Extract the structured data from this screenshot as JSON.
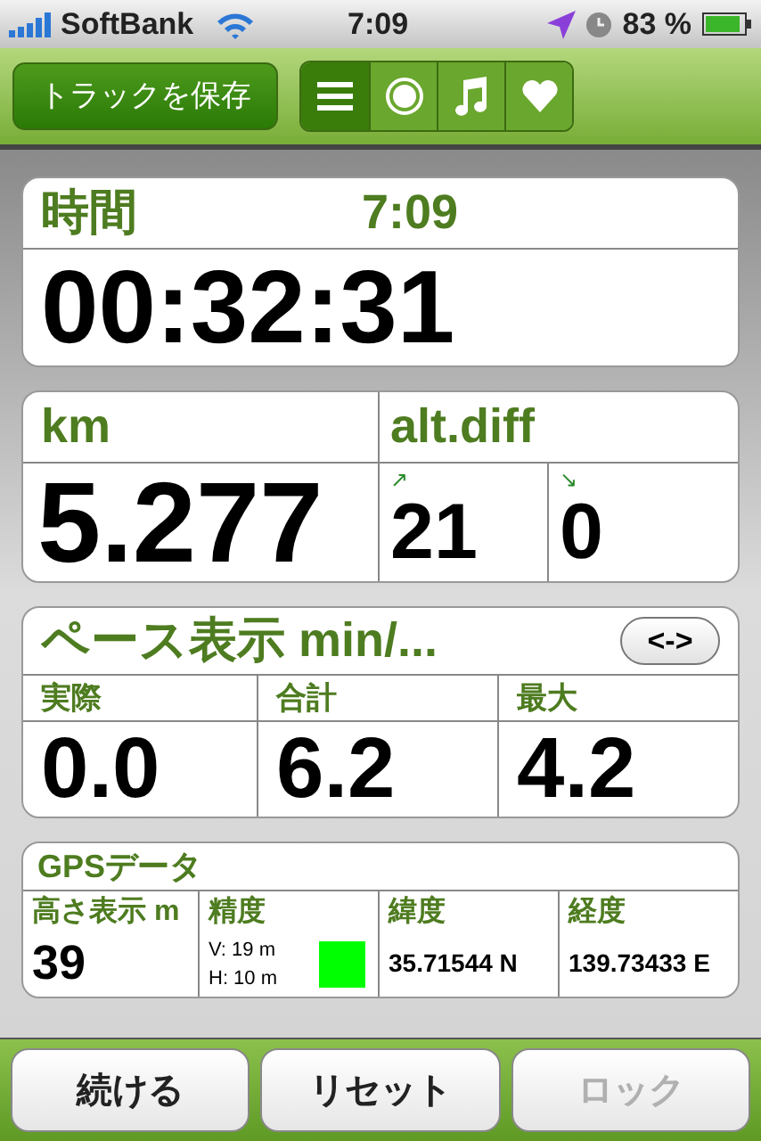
{
  "status_bar": {
    "carrier": "SoftBank",
    "time": "7:09",
    "battery": "83 %"
  },
  "toolbar": {
    "save_button": "トラックを保存",
    "segments": [
      {
        "kind": "list",
        "selected": true
      },
      {
        "kind": "record",
        "selected": false
      },
      {
        "kind": "music",
        "selected": false
      },
      {
        "kind": "heart",
        "selected": false
      }
    ]
  },
  "time_card": {
    "label": "時間",
    "clock": "7:09",
    "value": "00:32:31"
  },
  "distance_card": {
    "label": "km",
    "value": "5.277",
    "alt_label": "alt.diff",
    "up_arrow": "↗",
    "up": "21",
    "down_arrow": "↘",
    "down": "0"
  },
  "pace_card": {
    "label": "ペース表示 min/...",
    "toggle": "<->",
    "columns": [
      {
        "label": "実際",
        "value": "0.0"
      },
      {
        "label": "合計",
        "value": "6.2"
      },
      {
        "label": "最大",
        "value": "4.2"
      }
    ]
  },
  "gps_card": {
    "label": "GPSデータ",
    "altitude": {
      "label": "高さ表示 m",
      "value": "39"
    },
    "accuracy": {
      "label": "精度",
      "vertical": "V: 19 m",
      "horizontal": "H: 10 m",
      "color": "#00ff00"
    },
    "latitude": {
      "label": "緯度",
      "value": "35.71544 N"
    },
    "longitude": {
      "label": "経度",
      "value": "139.73433 E"
    }
  },
  "buttons": [
    {
      "label": "続ける",
      "disabled": false
    },
    {
      "label": "リセット",
      "disabled": false
    },
    {
      "label": "ロック",
      "disabled": true
    }
  ]
}
